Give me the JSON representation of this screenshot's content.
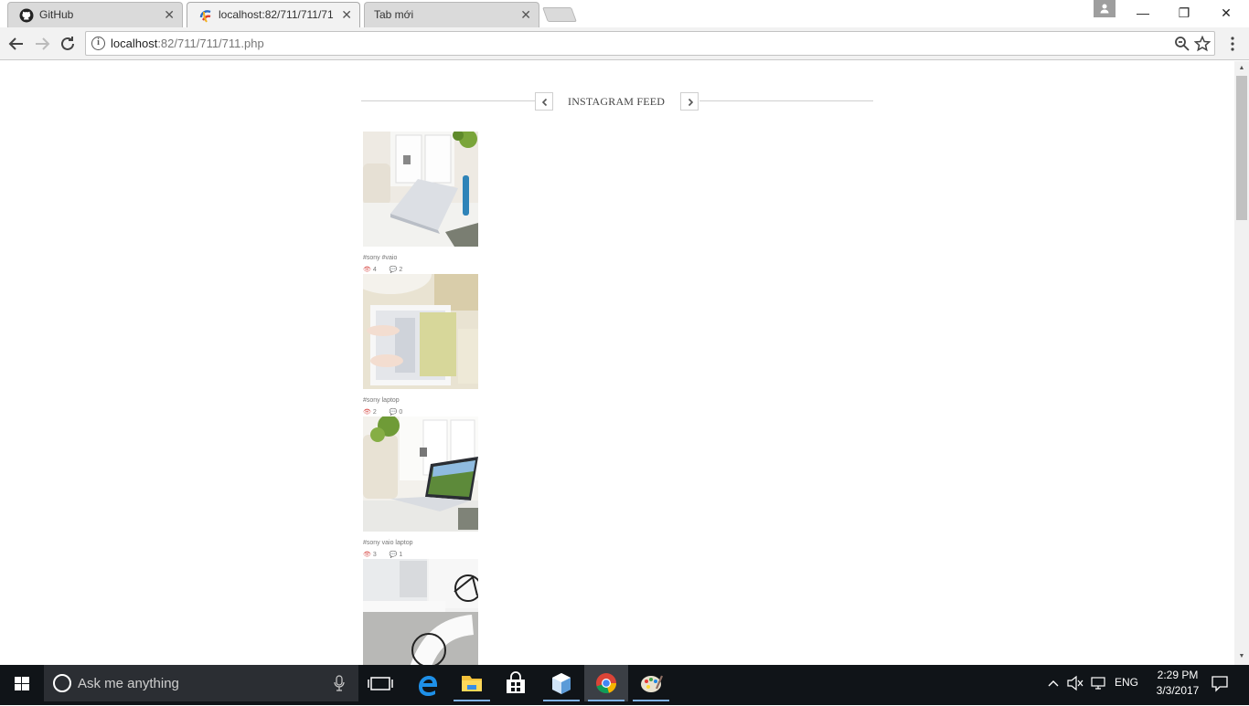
{
  "browser": {
    "tabs": [
      {
        "title": "GitHub",
        "favicon": "github-icon",
        "active": false
      },
      {
        "title": "localhost:82/711/711/71",
        "favicon": "site-icon",
        "active": true
      },
      {
        "title": "Tab mới",
        "favicon": "",
        "active": false
      }
    ],
    "close_glyph": "✕",
    "window_controls": {
      "minimize": "—",
      "restore": "❐",
      "close": "✕"
    },
    "url_host": "localhost",
    "url_rest": ":82/711/711/711.php",
    "info_glyph": "i"
  },
  "feed": {
    "title": "INSTAGRAM FEED",
    "posts": [
      {
        "caption": "#sony #vaio",
        "views": "4",
        "comments": "2",
        "image": "laptop-on-table"
      },
      {
        "caption": "#sony laptop",
        "views": "2",
        "comments": "0",
        "image": "hands-typing"
      },
      {
        "caption": "#sony vaio laptop",
        "views": "3",
        "comments": "1",
        "image": "laptop-room"
      },
      {
        "caption": "",
        "views": "",
        "comments": "",
        "image": "laptop-bicycle"
      }
    ]
  },
  "taskbar": {
    "search_placeholder": "Ask me anything",
    "language": "ENG",
    "time": "2:29 PM",
    "date": "3/3/2017",
    "apps": [
      "task-view-icon",
      "edge-icon",
      "file-explorer-icon",
      "store-icon",
      "box-app-icon",
      "chrome-icon",
      "paint-icon"
    ]
  },
  "colors": {
    "accent_red": "#d9534f",
    "taskbar_bg": "#101418",
    "tab_active_bg": "#f2f2f2"
  }
}
